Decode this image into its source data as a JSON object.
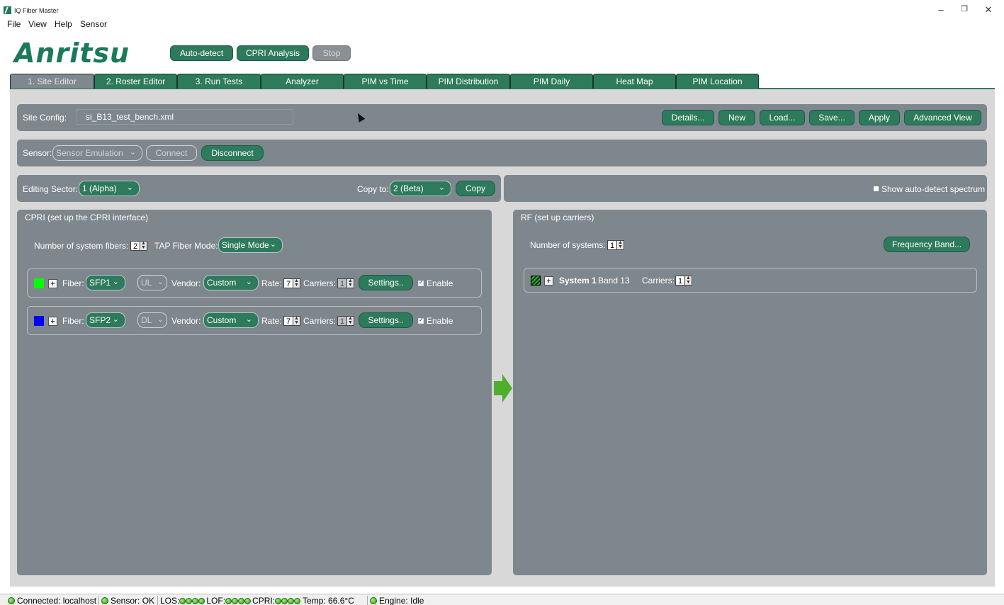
{
  "window": {
    "title": "IQ Fiber Master",
    "minimize": "–",
    "restore": "❐",
    "close": "✕"
  },
  "menu": [
    "File",
    "View",
    "Help",
    "Sensor"
  ],
  "brand": {
    "logo": "Anritsu",
    "color": "#1a7a5a"
  },
  "toolbar": {
    "autodetect": "Auto-detect",
    "cpri_analysis": "CPRI Analysis",
    "stop": "Stop"
  },
  "tabs": [
    "1. Site Editor",
    "2. Roster Editor",
    "3. Run Tests",
    "Analyzer",
    "PIM vs Time",
    "PIM Distribution",
    "PIM Daily",
    "Heat Map",
    "PIM Location"
  ],
  "site_config": {
    "label": "Site Config:",
    "file": "si_B13_test_bench.xml",
    "buttons": [
      "Details...",
      "New",
      "Load...",
      "Save...",
      "Apply",
      "Advanced View"
    ]
  },
  "sensor": {
    "label": "Sensor:",
    "selected": "Sensor Emulation",
    "connect": "Connect",
    "disconnect": "Disconnect"
  },
  "sector": {
    "label": "Editing Sector:",
    "selected": "1 (Alpha)",
    "copy_to_label": "Copy to:",
    "copy_to_selected": "2 (Beta)",
    "copy_button": "Copy",
    "show_spectrum": "Show auto-detect spectrum"
  },
  "cpri": {
    "title": "CPRI (set up the CPRI interface)",
    "num_fibers_label": "Number of system fibers:",
    "num_fibers": "2",
    "tap_mode_label": "TAP Fiber Mode:",
    "tap_mode": "Single Mode",
    "fibers": [
      {
        "color": "#00ff00",
        "fiber_label": "Fiber:",
        "fiber": "SFP1",
        "direction": "UL",
        "vendor_label": "Vendor:",
        "vendor": "Custom",
        "rate_label": "Rate:",
        "rate": "7",
        "carriers_label": "Carriers:",
        "carriers": "1",
        "settings": "Settings..",
        "enable": "Enable"
      },
      {
        "color": "#0000ff",
        "fiber_label": "Fiber:",
        "fiber": "SFP2",
        "direction": "DL",
        "vendor_label": "Vendor:",
        "vendor": "Custom",
        "rate_label": "Rate:",
        "rate": "7",
        "carriers_label": "Carriers:",
        "carriers": "1",
        "settings": "Settings..",
        "enable": "Enable"
      }
    ]
  },
  "rf": {
    "title": "RF (set up carriers)",
    "num_systems_label": "Number of systems:",
    "num_systems": "1",
    "freq_band_button": "Frequency Band...",
    "system": {
      "name": "System 1",
      "band": "Band 13",
      "carriers_label": "Carriers:",
      "carriers": "1"
    }
  },
  "status": {
    "connected": "Connected: localhost",
    "sensor": "Sensor: OK",
    "los": "LOS:",
    "lof": "LOF:",
    "cpri": "CPRI:",
    "temp": "Temp: 66.6°C",
    "engine": "Engine: Idle"
  }
}
